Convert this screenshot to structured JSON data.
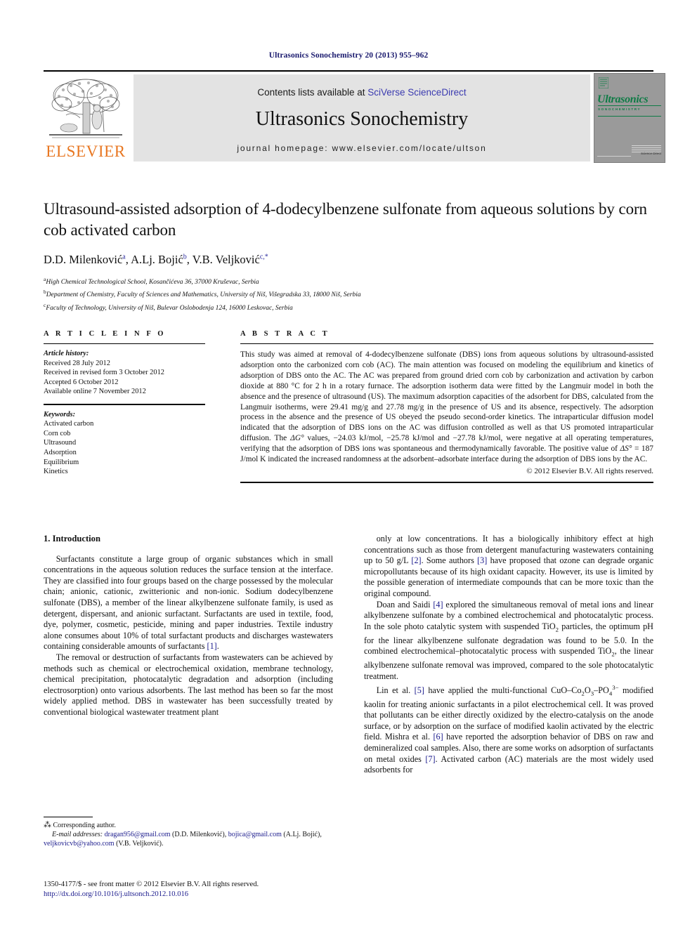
{
  "running_head": "Ultrasonics Sonochemistry 20 (2013) 955–962",
  "masthead": {
    "contents_prefix": "Contents lists available at ",
    "sciencedirect_link": "SciVerse ScienceDirect",
    "journal_name": "Ultrasonics Sonochemistry",
    "homepage": "journal homepage: www.elsevier.com/locate/ultson",
    "publisher_wordmark": "ELSEVIER",
    "cover": {
      "title": "Ultrasonics",
      "subtitle": "SONOCHEMISTRY",
      "footer_note": "Science Direct"
    }
  },
  "article": {
    "title": "Ultrasound-assisted adsorption of 4-dodecylbenzene sulfonate from aqueous solutions by corn cob activated carbon",
    "authors": [
      {
        "name": "D.D. Milenković",
        "marks": "a"
      },
      {
        "name": "A.Lj. Bojić",
        "marks": "b"
      },
      {
        "name": "V.B. Veljković",
        "marks": "c,*"
      }
    ],
    "affiliations": [
      {
        "mark": "a",
        "text": "High Chemical Technological School, Kosančićeva 36, 37000 Kruševac, Serbia"
      },
      {
        "mark": "b",
        "text": "Department of Chemistry, Faculty of Sciences and Mathematics, University of Niš, Višegradska 33, 18000 Niš, Serbia"
      },
      {
        "mark": "c",
        "text": "Faculty of Technology, University of Niš, Bulevar Oslobodenja 124, 16000 Leskovac, Serbia"
      }
    ]
  },
  "article_info": {
    "heading": "A R T I C L E    I N F O",
    "history_label": "Article history:",
    "history": [
      "Received 28 July 2012",
      "Received in revised form 3 October 2012",
      "Accepted 6 October 2012",
      "Available online 7 November 2012"
    ],
    "keywords_label": "Keywords:",
    "keywords": [
      "Activated carbon",
      "Corn cob",
      "Ultrasound",
      "Adsorption",
      "Equilibrium",
      "Kinetics"
    ]
  },
  "abstract": {
    "heading": "A B S T R A C T",
    "text_part1": "This study was aimed at removal of 4-dodecylbenzene sulfonate (DBS) ions from aqueous solutions by ultrasound-assisted adsorption onto the carbonized corn cob (AC). The main attention was focused on modeling the equilibrium and kinetics of adsorption of DBS onto the AC. The AC was prepared from ground dried corn cob by carbonization and activation by carbon dioxide at 880 °C for 2 h in a rotary furnace. The adsorption isotherm data were fitted by the Langmuir model in both the absence and the presence of ultrasound (US). The maximum adsorption capacities of the adsorbent for DBS, calculated from the Langmuir isotherms, were 29.41 mg/g and 27.78 mg/g in the presence of US and its absence, respectively. The adsorption process in the absence and the presence of US obeyed the pseudo second-order kinetics. The intraparticular diffusion model indicated that the adsorption of DBS ions on the AC was diffusion controlled as well as that US promoted intraparticular diffusion. The ",
    "delta_g": "ΔG°",
    "text_part2": " values, −24.03 kJ/mol, −25.78 kJ/mol and −27.78 kJ/mol, were negative at all operating temperatures, verifying that the adsorption of DBS ions was spontaneous and thermodynamically favorable. The positive value of ",
    "delta_s": "ΔS°",
    "text_part3": " = 187 J/mol K indicated the increased randomness at the adsorbent–adsorbate interface during the adsorption of DBS ions by the AC.",
    "copyright": "© 2012 Elsevier B.V. All rights reserved."
  },
  "introduction": {
    "section_number_title": "1. Introduction",
    "left_paragraphs": [
      "Surfactants constitute a large group of organic substances which in small concentrations in the aqueous solution reduces the surface tension at the interface. They are classified into four groups based on the charge possessed by the molecular chain; anionic, cationic, zwitterionic and non-ionic. Sodium dodecylbenzene sulfonate (DBS), a member of the linear alkylbenzene sulfonate family, is used as detergent, dispersant, and anionic surfactant. Surfactants are used in textile, food, dye, polymer, cosmetic, pesticide, mining and paper industries. Textile industry alone consumes about 10% of total surfactant products and discharges wastewaters containing considerable amounts of surfactants [1].",
      "The removal or destruction of surfactants from wastewaters can be achieved by methods such as chemical or electrochemical oxidation, membrane technology, chemical precipitation, photocatalytic degradation and adsorption (including electrosorption) onto various adsorbents. The last method has been so far the most widely applied method. DBS in wastewater has been successfully treated by conventional biological wastewater treatment plant"
    ],
    "right_paragraphs": [
      "only at low concentrations. It has a biologically inhibitory effect at high concentrations such as those from detergent manufacturing wastewaters containing up to 50 g/L [2]. Some authors [3] have proposed that ozone can degrade organic micropollutants because of its high oxidant capacity. However, its use is limited by the possible generation of intermediate compounds that can be more toxic than the original compound.",
      "Doan and Saidi [4] explored the simultaneous removal of metal ions and linear alkylbenzene sulfonate by a combined electrochemical and photocatalytic process. In the sole photo catalytic system with suspended TiO2 particles, the optimum pH for the linear alkylbenzene sulfonate degradation was found to be 5.0. In the combined electrochemical–photocatalytic process with suspended TiO2, the linear alkylbenzene sulfonate removal was improved, compared to the sole photocatalytic treatment.",
      "Lin et al. [5] have applied the multi-functional CuO–Co2O3–PO43− modified kaolin for treating anionic surfactants in a pilot electrochemical cell. It was proved that pollutants can be either directly oxidized by the electro-catalysis on the anode surface, or by adsorption on the surface of modified kaolin activated by the electric field. Mishra et al. [6] have reported the adsorption behavior of DBS on raw and demineralized coal samples. Also, there are some works on adsorption of surfactants on metal oxides [7]. Activated carbon (AC) materials are the most widely used adsorbents for"
    ]
  },
  "footnotes": {
    "corresponding": "Corresponding author.",
    "email_label": "E-mail addresses:",
    "emails": [
      {
        "address": "dragan956@gmail.com",
        "owner": "(D.D. Milenković)"
      },
      {
        "address": "bojica@gmail.com",
        "owner": "(A.Lj. Bojić)"
      },
      {
        "address": "veljkovicvb@yahoo.com",
        "owner": "(V.B. Veljković)"
      }
    ],
    "issn_line": "1350-4177/$ - see front matter © 2012 Elsevier B.V. All rights reserved.",
    "doi": "http://dx.doi.org/10.1016/j.ultsonch.2012.10.016"
  },
  "colors": {
    "link_blue": "#1a1a8c",
    "elsevier_orange": "#e87722",
    "cover_green": "#0f7b46",
    "banner_gray": "#e3e3e3"
  }
}
